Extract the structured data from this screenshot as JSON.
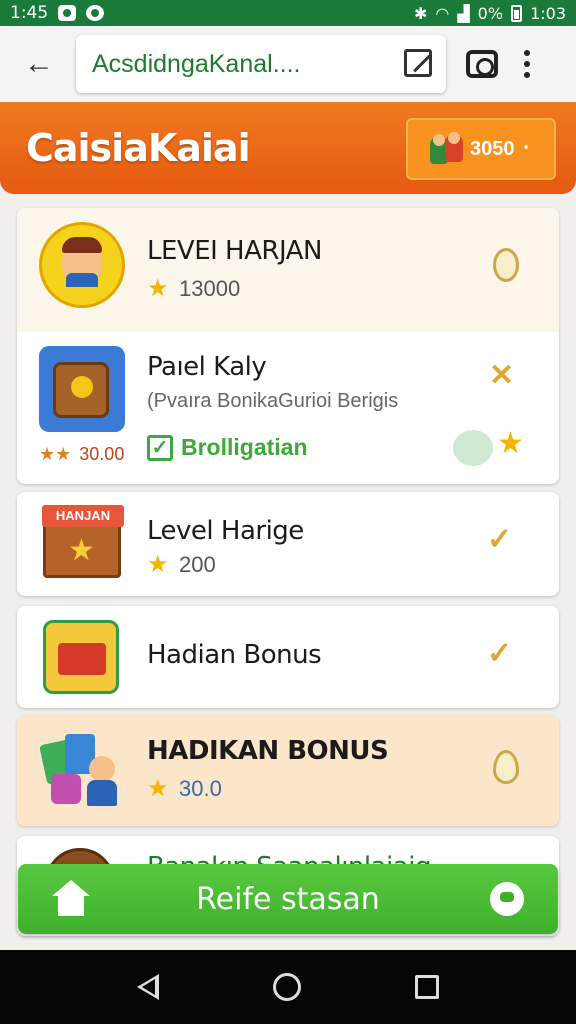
{
  "status_bar": {
    "time": "1:45",
    "battery_text": "0%",
    "clock_right": "1:03"
  },
  "browser": {
    "url_text": "AcsdidngaKanal...."
  },
  "header": {
    "app_title": "CaisiaKaiai",
    "coin_value": "3050 ᛫"
  },
  "list": [
    {
      "title": "LEVEI HARJAN",
      "sub_value": "13000",
      "trailing": "oval"
    },
    {
      "title": "Paıel Kaly",
      "subtitle": "(Pvaıra BonikaGurioi Berigis",
      "rating_value": "30.00",
      "tag_label": "Brolligatian",
      "trailing": "close"
    },
    {
      "title": "Level Harige",
      "sub_value": "200",
      "badge_text": "HANJAN",
      "trailing": "check"
    },
    {
      "title": "Hadian Bonus",
      "trailing": "check"
    },
    {
      "title": "HADIKAN BONUS",
      "sub_value": "30.0",
      "trailing": "oval"
    },
    {
      "title": "Banakın Saanalınlaiaig"
    }
  ],
  "bottom_button": {
    "label": "Reife stasan"
  },
  "colors": {
    "header_orange": "#e55a10",
    "status_green": "#1a7a3a",
    "button_green": "#3fb02b",
    "gold": "#d9a931"
  }
}
